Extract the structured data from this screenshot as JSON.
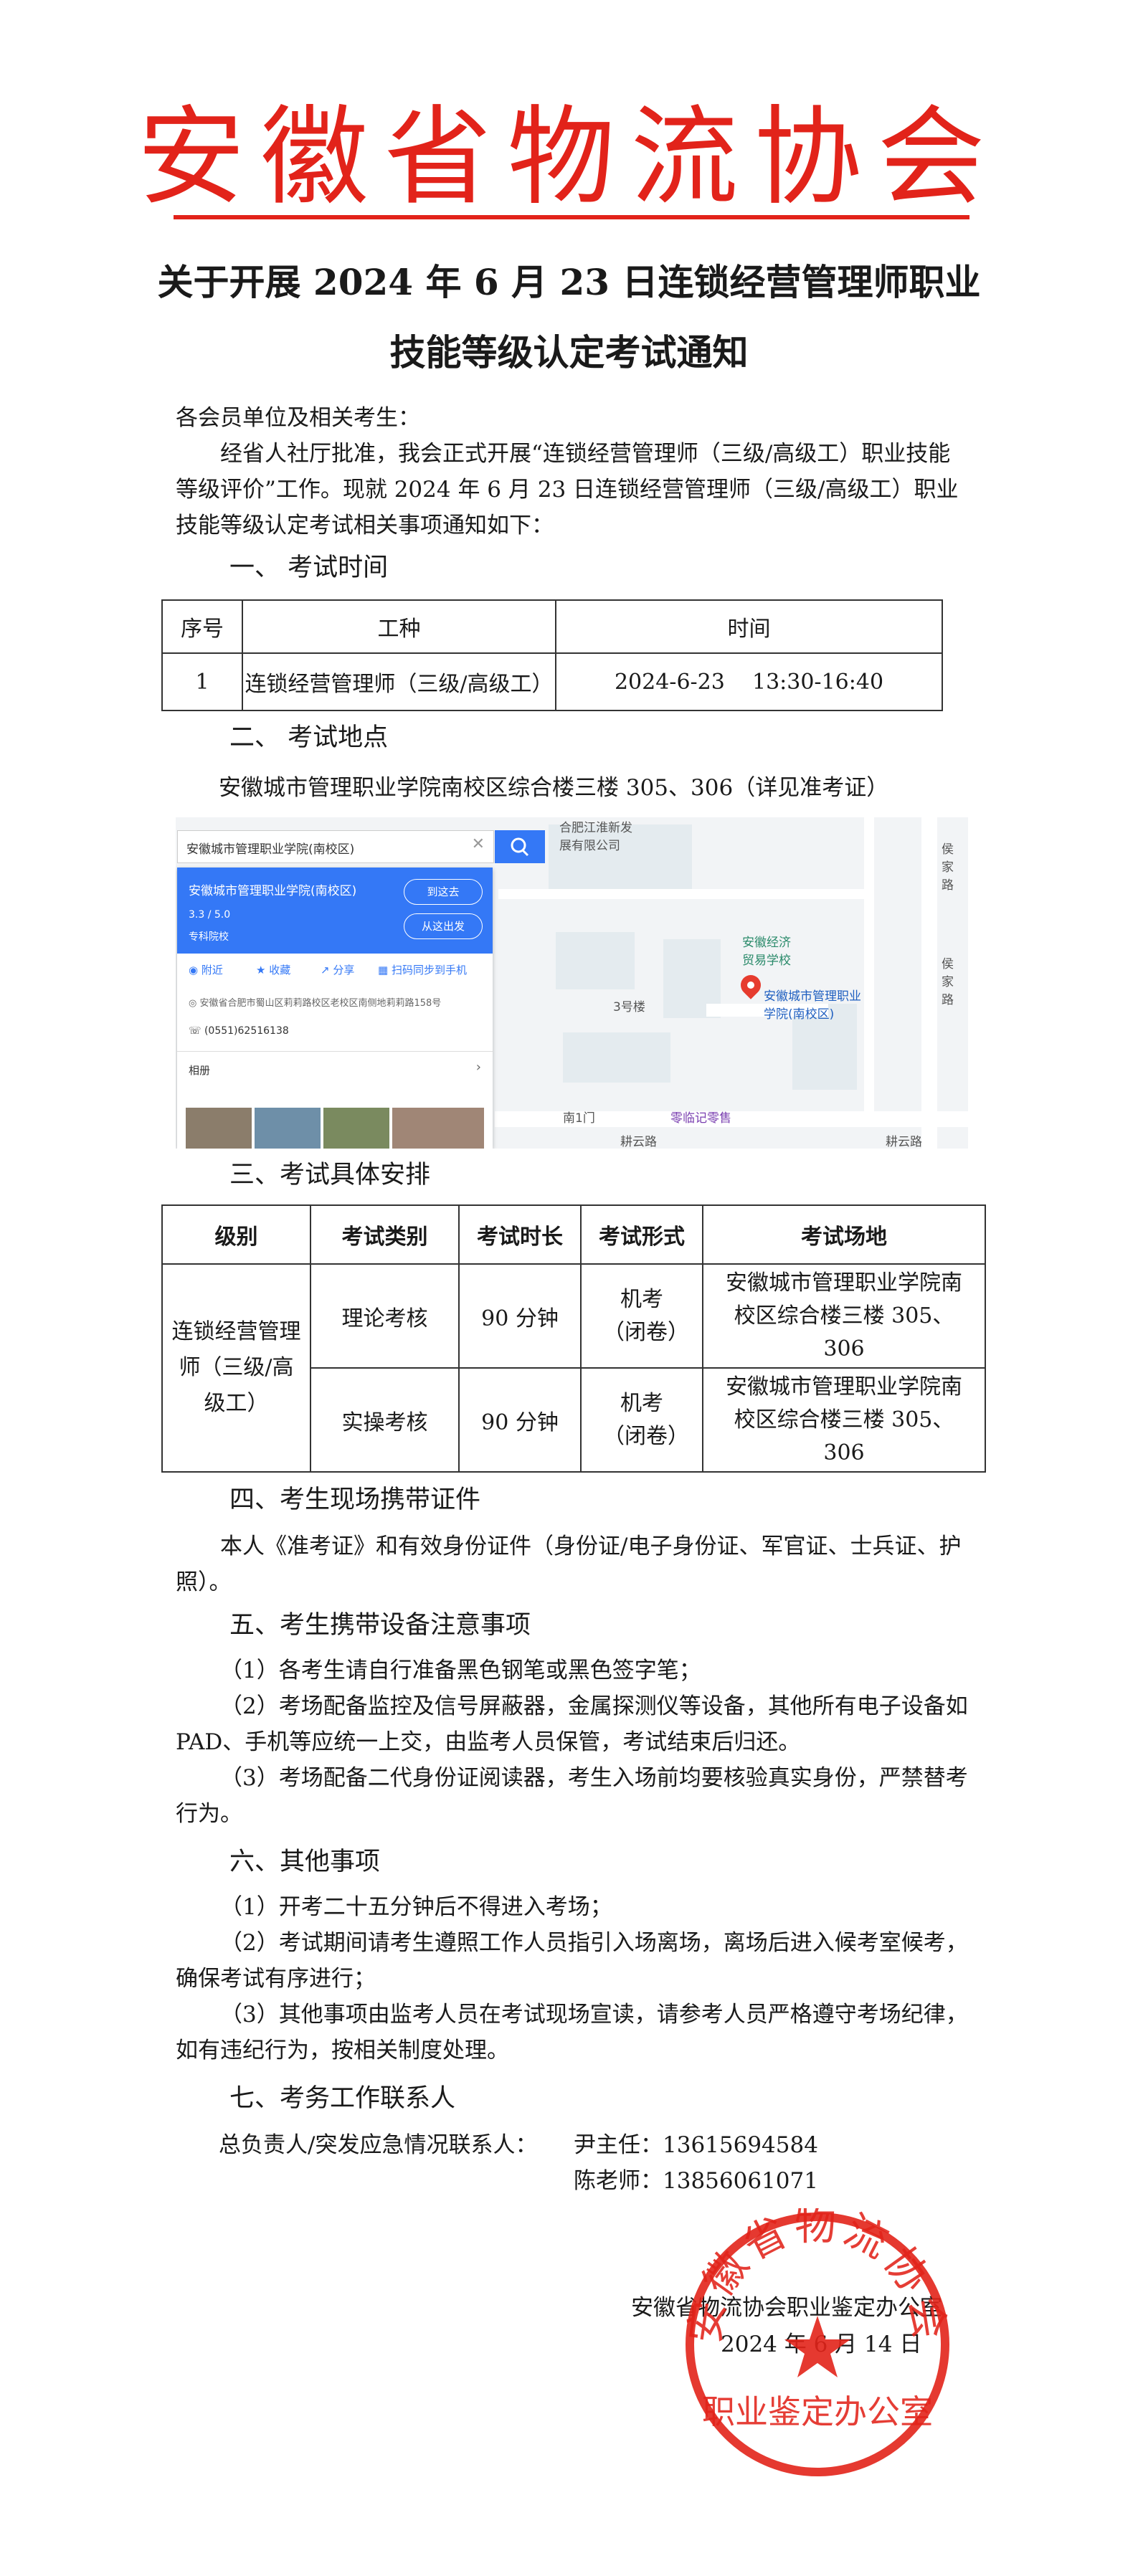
{
  "header": {
    "org_name": "安徽省物流协会",
    "title_line1": "关于开展 2024 年 6 月 23 日连锁经营管理师职业",
    "title_line2": "技能等级认定考试通知"
  },
  "intro": {
    "salutation": "各会员单位及相关考生：",
    "paragraph": "经省人社厅批准，我会正式开展“连锁经营管理师（三级/高级工）职业技能等级评价”工作。现就 2024 年 6 月 23 日连锁经营管理师（三级/高级工）职业技能等级认定考试相关事项通知如下："
  },
  "section1": {
    "heading": "一、  考试时间",
    "table": {
      "headers": [
        "序号",
        "工种",
        "时间"
      ],
      "rows": [
        [
          "1",
          "连锁经营管理师（三级/高级工）",
          "2024-6-23    13:30-16:40"
        ]
      ]
    }
  },
  "section2": {
    "heading": "二、  考试地点",
    "address": "安徽城市管理职业学院南校区综合楼三楼 305、306（详见准考证）",
    "map": {
      "search_text": "安徽城市管理职业学院(南校区)",
      "place_name": "安徽城市管理职业学院(南校区)",
      "rating": "3.3 / 5.0",
      "category": "专科院校",
      "btn_route": "到这去",
      "btn_depart": "从这出发",
      "actions": [
        "附近",
        "收藏",
        "分享",
        "扫码同步到手机"
      ],
      "address_line": "安徽省合肥市蜀山区莉莉路校区老校区南侧地莉莉路158号",
      "phone": "(0551)62516138",
      "album": "相册",
      "labels": {
        "company": "合肥江淮新发\n展有限公司",
        "school": "安徽经济\n贸易学校",
        "campus": "安徽城市管理职业\n学院(南校区)",
        "building": "3号楼",
        "gate": "南1门",
        "shop": "零临记零售",
        "road1": "耕云路",
        "road2": "耕云路",
        "road3": "侯家路",
        "road4": "侯家路"
      }
    }
  },
  "section3": {
    "heading": "三、考试具体安排",
    "table": {
      "headers": [
        "级别",
        "考试类别",
        "考试时长",
        "考试形式",
        "考试场地"
      ],
      "level": "连锁经营管理师（三级/高级工）",
      "rows": [
        {
          "type": "理论考核",
          "duration": "90 分钟",
          "form": "机考（闭卷）",
          "venue": "安徽城市管理职业学院南校区综合楼三楼 305、306"
        },
        {
          "type": "实操考核",
          "duration": "90 分钟",
          "form": "机考（闭卷）",
          "venue": "安徽城市管理职业学院南校区综合楼三楼 305、306"
        }
      ]
    }
  },
  "section4": {
    "heading": "四、考生现场携带证件",
    "text": "本人《准考证》和有效身份证件（身份证/电子身份证、军官证、士兵证、护照）。"
  },
  "section5": {
    "heading": "五、考生携带设备注意事项",
    "items": [
      "（1）各考生请自行准备黑色钢笔或黑色签字笔；",
      "（2）考场配备监控及信号屏蔽器，金属探测仪等设备，其他所有电子设备如 PAD、手机等应统一上交，由监考人员保管，考试结束后归还。",
      "（3）考场配备二代身份证阅读器，考生入场前均要核验真实身份，严禁替考行为。"
    ]
  },
  "section6": {
    "heading": "六、其他事项",
    "items": [
      "（1）开考二十五分钟后不得进入考场；",
      "（2）考试期间请考生遵照工作人员指引入场离场，离场后进入候考室候考，确保考试有序进行；",
      "（3）其他事项由监考人员在考试现场宣读，请参考人员严格遵守考场纪律，如有违纪行为，按相关制度处理。"
    ]
  },
  "section7": {
    "heading": "七、考务工作联系人",
    "label": "总负责人/突发应急情况联系人：",
    "contacts": [
      "尹主任：13615694584",
      "陈老师：13856061071"
    ]
  },
  "signature": {
    "office": "安徽省物流协会职业鉴定办公室",
    "date": "2024 年 6 月 14 日",
    "seal_top": "安徽省物流协会",
    "seal_bottom": "职业鉴定办公室",
    "seal_color": "#e2231a"
  }
}
